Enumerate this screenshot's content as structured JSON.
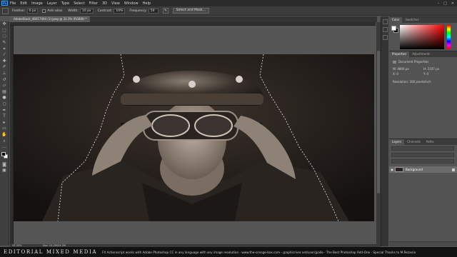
{
  "menubar": {
    "logo": "Ps",
    "items": [
      "File",
      "Edit",
      "Image",
      "Layer",
      "Type",
      "Select",
      "Filter",
      "3D",
      "View",
      "Window",
      "Help"
    ]
  },
  "options": {
    "feather_label": "Feather:",
    "feather_value": "0 px",
    "anti_alias_label": "Anti-alias",
    "width_label": "Width:",
    "width_value": "10 px",
    "contrast_label": "Contrast:",
    "contrast_value": "10%",
    "frequency_label": "Frequency:",
    "frequency_value": "50",
    "select_mask_label": "Select and Mask..."
  },
  "document": {
    "tab_title": "AdobeStock_48017404 (1).jpeg @ 33.3% (RGB/8) *",
    "zoom": "33.33%",
    "doc_size": "Doc: 24.2M/24.2M"
  },
  "panels": {
    "color_tabs": [
      "Color",
      "Swatches"
    ],
    "props_tabs": [
      "Properties",
      "Adjustments"
    ],
    "props_title": "Document Properties",
    "props_w": "W: 4800 px",
    "props_h": "H: 2107 px",
    "props_x": "X: 0",
    "props_y": "Y: 0",
    "props_resolution": "Resolution: 300 pixels/inch",
    "layers_tabs": [
      "Layers",
      "Channels",
      "Paths"
    ],
    "layer_name": "Background"
  },
  "caption": {
    "brand": "EDITORIAL MIXED MEDIA",
    "text": "FX Actionscript works with Adobe Photoshop CC in any language with any image resolution - www.the-orange-box.com - graphicriver.net/user/giallo - The Best Photoshop Add-One - Special Thanks to M.Rezania"
  },
  "colors": {
    "accent": "#31a8ff",
    "selected_layer": "#6b6b6b"
  }
}
